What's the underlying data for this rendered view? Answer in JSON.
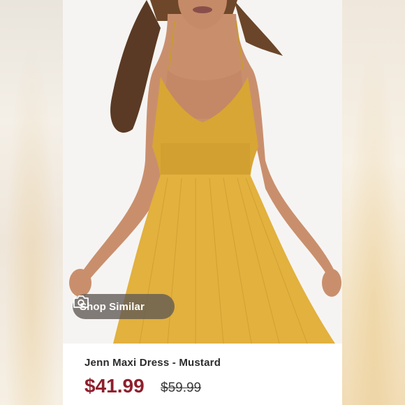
{
  "listing": {
    "title": "Jenn Maxi Dress - Mustard",
    "price": "$41.99",
    "original_price": "$59.99",
    "price_color": "#8e1f2d",
    "dress_color": "#e5b33b"
  },
  "photo": {
    "alt": "Model wearing mustard maxi dress"
  },
  "shop_similar": {
    "label": "Shop Similar",
    "icon": "camera-icon"
  }
}
